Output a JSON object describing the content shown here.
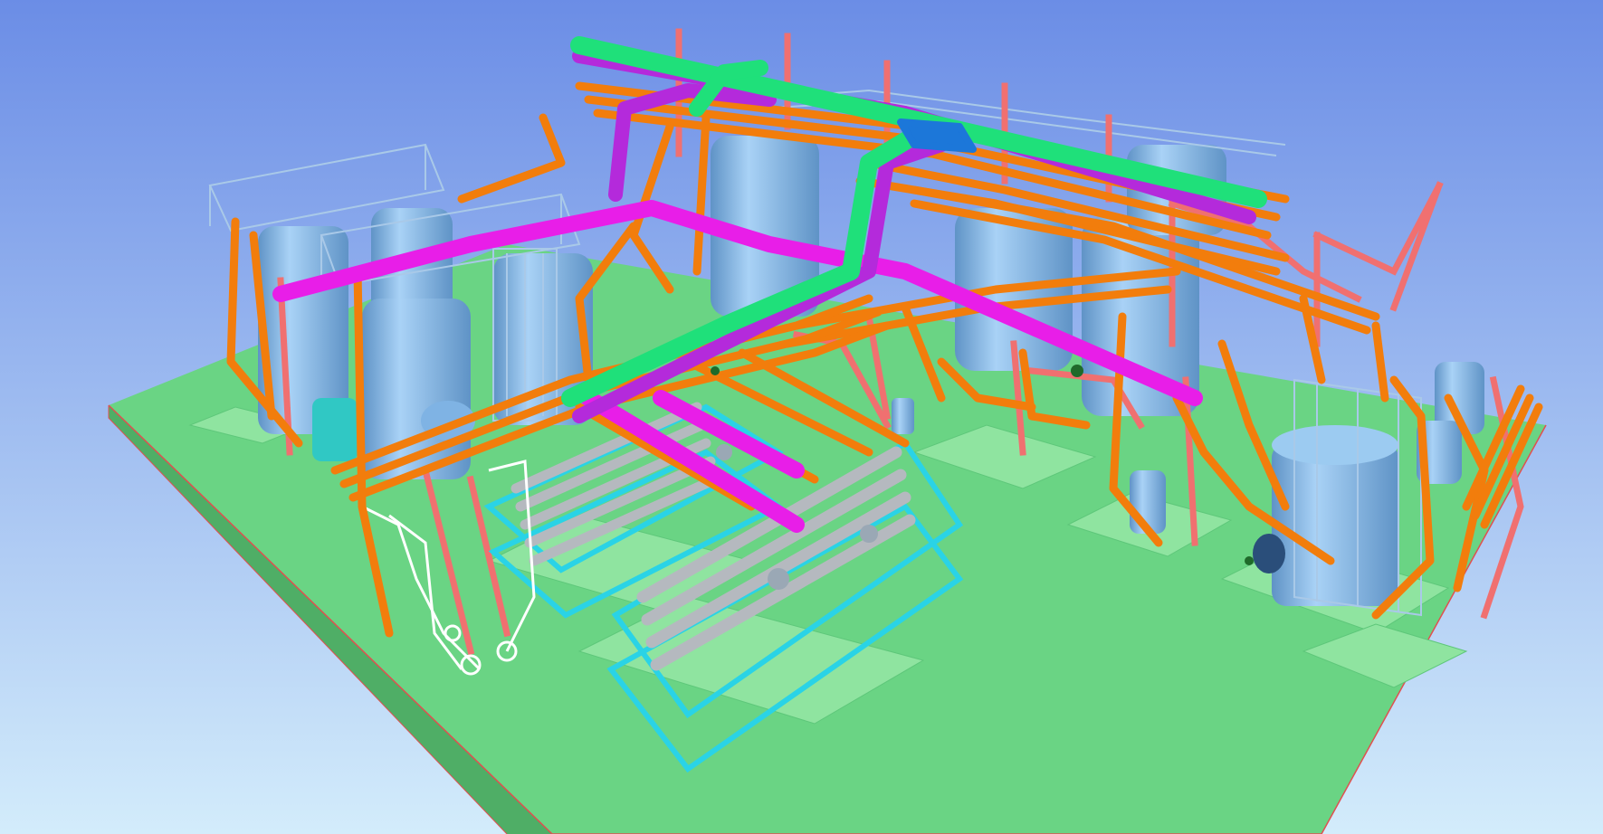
{
  "viewport": {
    "sky_top": "#6b8de6",
    "sky_bottom": "#d3ecfb"
  },
  "palette": {
    "floor": "#6ad484",
    "floor_edge": "#e05050",
    "slab": "#8fe4a0",
    "vessel": "#8ec2ee",
    "vessel_dark": "#5f93c6",
    "railing": "#a9c9e8",
    "pipe_orange": "#f27d0c",
    "pipe_magenta": "#e81ee8",
    "pipe_purple": "#b42adb",
    "pipe_green": "#1fe07a",
    "pipe_blue": "#1c77d9",
    "steel_red": "#f07070",
    "pipe_cyan": "#2ad3e6",
    "filter_grey": "#b5b9bf",
    "pipe_white": "#ffffff",
    "pump_teal": "#30c8c4"
  }
}
